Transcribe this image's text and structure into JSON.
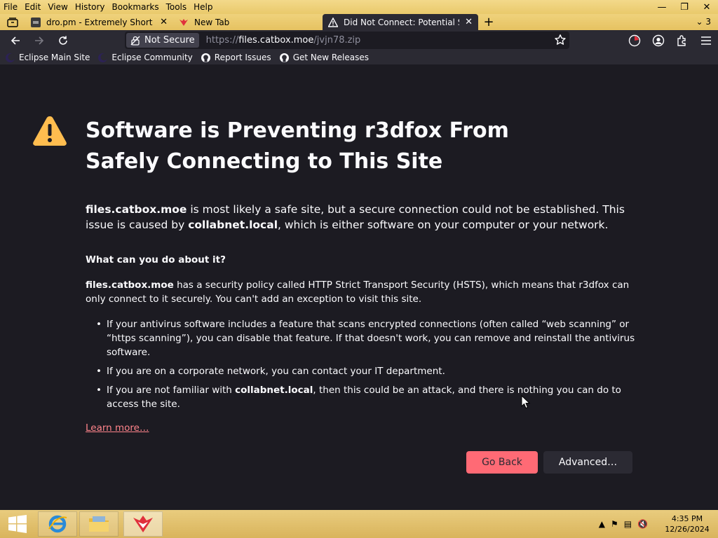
{
  "menu": [
    "File",
    "Edit",
    "View",
    "History",
    "Bookmarks",
    "Tools",
    "Help"
  ],
  "tabs": [
    {
      "label": "dro.pm - Extremely Short Links"
    },
    {
      "label": "New Tab"
    },
    {
      "label": "Did Not Connect: Potential Security Issue"
    }
  ],
  "tab_count": "3",
  "urlbar": {
    "security_label": "Not Secure",
    "url_prefix": "https://",
    "url_host": "files.catbox.moe",
    "url_path": "/jvjn78.zip"
  },
  "bookmarks": [
    "Eclipse Main Site",
    "Eclipse Community",
    "Report Issues",
    "Get New Releases"
  ],
  "error": {
    "title": "Software is Preventing r3dfox From Safely Connecting to This Site",
    "intro_host": "files.catbox.moe",
    "intro_text_1": " is most likely a safe site, but a secure connection could not be established. This issue is caused by ",
    "intro_mitm": "collabnet.local",
    "intro_text_2": ", which is either software on your computer or your network.",
    "question": "What can you do about it?",
    "hsts_host": "files.catbox.moe",
    "hsts_text": " has a security policy called HTTP Strict Transport Security (HSTS), which means that r3dfox can only connect to it securely. You can't add an exception to visit this site.",
    "tip1": "If your antivirus software includes a feature that scans encrypted connections (often called “web scanning” or “https scanning”), you can disable that feature. If that doesn't work, you can remove and reinstall the antivirus software.",
    "tip2": "If you are on a corporate network, you can contact your IT department.",
    "tip3_a": "If you are not familiar with ",
    "tip3_host": "collabnet.local",
    "tip3_b": ", then this could be an attack, and there is nothing you can do to access the site.",
    "learn_more": "Learn more…",
    "go_back": "Go Back",
    "advanced": "Advanced…"
  },
  "taskbar": {
    "time": "4:35 PM",
    "date": "12/26/2024"
  },
  "colors": {
    "page_bg": "#1c1b22",
    "chrome_bg": "#2b2a33",
    "accent": "#ff6a75",
    "warning": "#ffbd4f",
    "link": "#ff848b",
    "theme_gold": "#e9c96b"
  }
}
